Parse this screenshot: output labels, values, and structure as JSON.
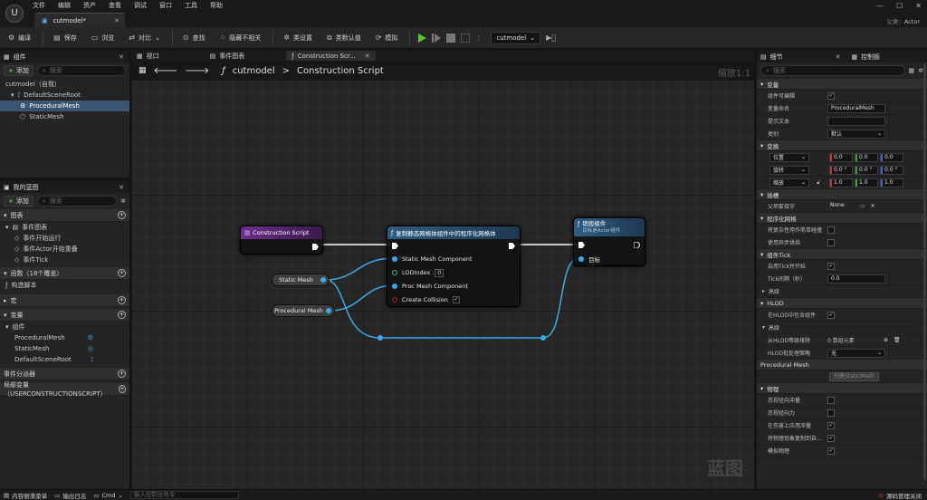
{
  "menu": [
    "文件",
    "编辑",
    "资产",
    "查看",
    "调试",
    "窗口",
    "工具",
    "帮助"
  ],
  "document_tab": "cutmodel*",
  "parent": {
    "label": "父类：",
    "value": "Actor"
  },
  "toolbar": {
    "compile": "编译",
    "save": "保存",
    "browse": "浏览",
    "diff": "对比",
    "find": "查找",
    "hide_unrelated": "隐藏不相关",
    "class_settings": "类设置",
    "class_defaults": "类默认值",
    "simulate": "模拟",
    "debug_object": "cutmodel"
  },
  "components_panel": {
    "title": "组件",
    "add": "添加",
    "search_placeholder": "搜索",
    "items": [
      "cutmodel（自我）",
      "DefaultSceneRoot",
      "ProceduralMesh",
      "StaticMesh"
    ]
  },
  "my_blueprint": {
    "title": "我的蓝图",
    "add": "添加",
    "search_placeholder": "搜索",
    "graphs_header": "图表",
    "event_graph": "事件图表",
    "events": [
      "事件开始运行",
      "事件Actor开始重叠",
      "事件Tick"
    ],
    "functions_header": "函数（18个覆盖）",
    "construction_script": "构造脚本",
    "macros_header": "宏",
    "variables_header": "变量",
    "components_header": "组件",
    "variables": [
      "ProceduralMesh",
      "StaticMesh",
      "DefaultSceneRoot"
    ],
    "dispatchers_header": "事件分派器",
    "locals_header": "局部变量（USERCONSTRUCTIONSCRIPT）"
  },
  "graph": {
    "tabs": [
      "视口",
      "事件图表",
      "Construction Scr..."
    ],
    "breadcrumb_root": "cutmodel",
    "breadcrumb_sep": ">",
    "breadcrumb_current": "Construction Script",
    "zoom": "缩放1:1",
    "watermark": "蓝图",
    "nodes": {
      "construction": {
        "title": "Construction Script"
      },
      "copy": {
        "title": "复制静态网格体组件中的程序化网格体",
        "pins": [
          "Static Mesh Component",
          "LODIndex",
          "Proc Mesh Component",
          "Create Collision"
        ],
        "lod_value": "0",
        "collision_checked": "✓"
      },
      "destroy": {
        "title": "销毁组件",
        "subtitle": "目标是Actor组件",
        "target": "目标"
      },
      "static_mesh": {
        "label": "Static Mesh"
      },
      "procedural_mesh": {
        "label": "Procedural Mesh"
      }
    }
  },
  "details": {
    "tabs": [
      "细节",
      "控制板"
    ],
    "search_placeholder": "搜索",
    "sections": {
      "variable": "变量",
      "transform": "变换",
      "sockets": "插槽",
      "procedural_mesh_section": "程序化网格",
      "component_tick": "组件Tick",
      "advanced": "高级",
      "hlod": "HLOD",
      "procedural_mesh": "Procedural Mesh",
      "physics": "物理"
    },
    "variable_rows": {
      "editable": "组件可编辑",
      "name_label": "变量命名",
      "name_value": "ProceduralMesh",
      "tooltip": "提示文本",
      "category": "类别",
      "category_value": "默认"
    },
    "transform": {
      "location": "位置",
      "rotation": "旋转",
      "scale": "缩放",
      "location_values": [
        "0.0",
        "0.0",
        "0.0"
      ],
      "rotation_values": [
        "0.0 °",
        "0.0 °",
        "0.0 °"
      ],
      "scale_values": [
        "1.0",
        "1.0",
        "1.0"
      ]
    },
    "sockets": {
      "parent_socket": "父项套接字",
      "value": "None"
    },
    "procedural": {
      "simple_collision": "将复杂性用作简单碰撞",
      "async_cooking": "使用异步烘焙"
    },
    "tick": {
      "start_with_tick": "启用Tick并开始",
      "tick_interval": "Tick间隔（秒）",
      "tick_value": "0.0"
    },
    "hlod": {
      "include": "在HLOD中包含组件"
    },
    "hlod_advanced": {
      "exclude_levels": "从HLOD等级排除",
      "exclude_value": "0 数组元素",
      "batching": "HLOD批处理策略",
      "batching_value": "无"
    },
    "procedural_mesh_btn": "创建StaticMesh",
    "physics": {
      "simulate_generates_hit": "忽视径向冲量",
      "ignore_force": "忽视径向力",
      "apply_impulse": "在伤害上应用冲量",
      "replicate": "将物理现象复制到自...",
      "simulate": "模拟物理"
    }
  },
  "statusbar": {
    "content_drawer": "内容侧滑菜单",
    "output_log": "输出日志",
    "cmd": "Cmd",
    "console_placeholder": "输入控制台命令",
    "source_control": "源码管理关闭"
  },
  "colors": {
    "construction_header": "#6a2e8c",
    "function_header": "#2e5d80",
    "exec": "#ffffff",
    "object_pin": "#3ca9e6",
    "bool_pin": "#8c1e1e",
    "int_pin": "#2fc3a5",
    "play": "#59c238"
  }
}
